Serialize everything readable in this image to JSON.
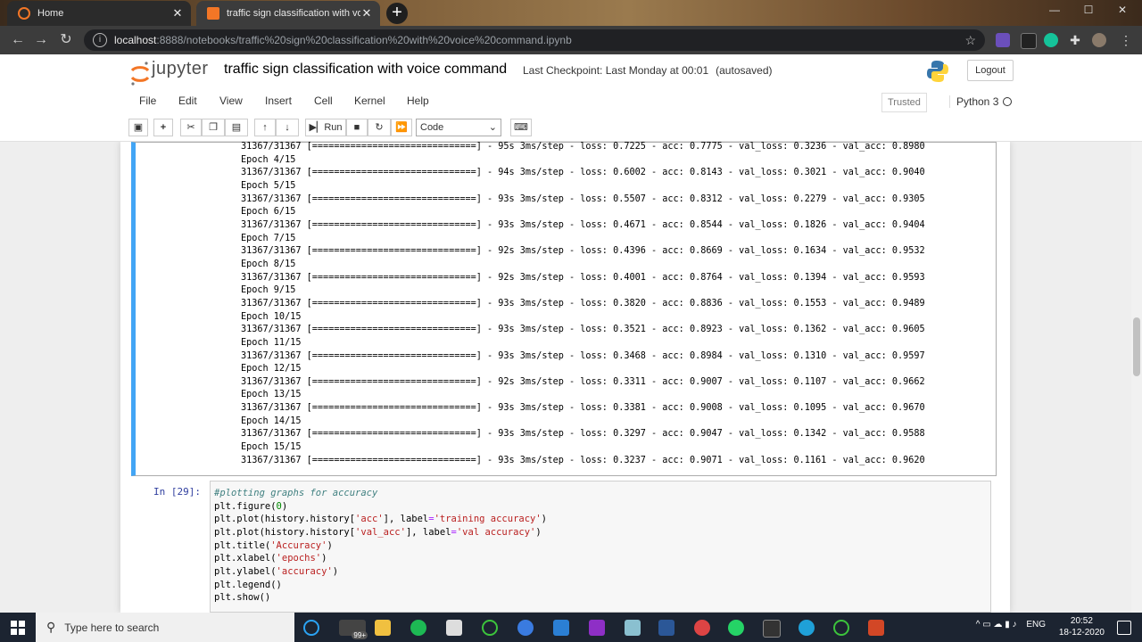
{
  "browser": {
    "tabs": [
      {
        "label": "Home"
      },
      {
        "label": "traffic sign classification with voice c"
      }
    ],
    "url_host": "localhost",
    "url_path": ":8888/notebooks/traffic%20sign%20classification%20with%20voice%20command.ipynb"
  },
  "header": {
    "logo_text": "jupyter",
    "notebook_title": "traffic sign classification with voice command",
    "checkpoint": "Last Checkpoint: Last Monday at 00:01",
    "autosaved": "(autosaved)",
    "logout_label": "Logout"
  },
  "menubar": {
    "items": [
      "File",
      "Edit",
      "View",
      "Insert",
      "Cell",
      "Kernel",
      "Help"
    ],
    "trusted": "Trusted",
    "kernel": "Python 3"
  },
  "toolbar": {
    "run_label": "Run",
    "cell_type": "Code"
  },
  "output": {
    "lines": [
      "31367/31367 [==============================] - 95s 3ms/step - loss: 0.7225 - acc: 0.7775 - val_loss: 0.3236 - val_acc: 0.8980",
      "Epoch 4/15",
      "31367/31367 [==============================] - 94s 3ms/step - loss: 0.6002 - acc: 0.8143 - val_loss: 0.3021 - val_acc: 0.9040",
      "Epoch 5/15",
      "31367/31367 [==============================] - 93s 3ms/step - loss: 0.5507 - acc: 0.8312 - val_loss: 0.2279 - val_acc: 0.9305",
      "Epoch 6/15",
      "31367/31367 [==============================] - 93s 3ms/step - loss: 0.4671 - acc: 0.8544 - val_loss: 0.1826 - val_acc: 0.9404",
      "Epoch 7/15",
      "31367/31367 [==============================] - 92s 3ms/step - loss: 0.4396 - acc: 0.8669 - val_loss: 0.1634 - val_acc: 0.9532",
      "Epoch 8/15",
      "31367/31367 [==============================] - 92s 3ms/step - loss: 0.4001 - acc: 0.8764 - val_loss: 0.1394 - val_acc: 0.9593",
      "Epoch 9/15",
      "31367/31367 [==============================] - 93s 3ms/step - loss: 0.3820 - acc: 0.8836 - val_loss: 0.1553 - val_acc: 0.9489",
      "Epoch 10/15",
      "31367/31367 [==============================] - 93s 3ms/step - loss: 0.3521 - acc: 0.8923 - val_loss: 0.1362 - val_acc: 0.9605",
      "Epoch 11/15",
      "31367/31367 [==============================] - 93s 3ms/step - loss: 0.3468 - acc: 0.8984 - val_loss: 0.1310 - val_acc: 0.9597",
      "Epoch 12/15",
      "31367/31367 [==============================] - 92s 3ms/step - loss: 0.3311 - acc: 0.9007 - val_loss: 0.1107 - val_acc: 0.9662",
      "Epoch 13/15",
      "31367/31367 [==============================] - 93s 3ms/step - loss: 0.3381 - acc: 0.9008 - val_loss: 0.1095 - val_acc: 0.9670",
      "Epoch 14/15",
      "31367/31367 [==============================] - 93s 3ms/step - loss: 0.3297 - acc: 0.9047 - val_loss: 0.1342 - val_acc: 0.9588",
      "Epoch 15/15",
      "31367/31367 [==============================] - 93s 3ms/step - loss: 0.3237 - acc: 0.9071 - val_loss: 0.1161 - val_acc: 0.9620"
    ]
  },
  "input_cell": {
    "prompt": "In [29]:",
    "code": [
      "#plotting graphs for accuracy",
      "plt.figure(0)",
      "plt.plot(history.history['acc'], label='training accuracy')",
      "plt.plot(history.history['val_acc'], label='val accuracy')",
      "plt.title('Accuracy')",
      "plt.xlabel('epochs')",
      "plt.ylabel('accuracy')",
      "plt.legend()",
      "plt.show()"
    ]
  },
  "taskbar": {
    "search_placeholder": "Type here to search",
    "badge": "99+",
    "lang": "ENG",
    "time": "20:52",
    "date": "18-12-2020"
  }
}
